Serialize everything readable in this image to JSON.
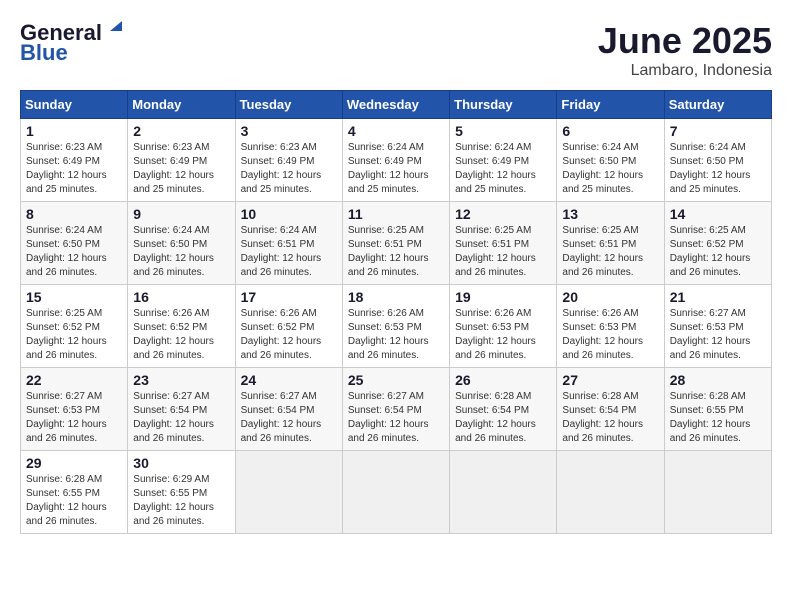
{
  "header": {
    "logo_line1": "General",
    "logo_line2": "Blue",
    "month": "June 2025",
    "location": "Lambaro, Indonesia"
  },
  "weekdays": [
    "Sunday",
    "Monday",
    "Tuesday",
    "Wednesday",
    "Thursday",
    "Friday",
    "Saturday"
  ],
  "weeks": [
    [
      {
        "day": "1",
        "sunrise": "6:23 AM",
        "sunset": "6:49 PM",
        "daylight": "12 hours and 25 minutes."
      },
      {
        "day": "2",
        "sunrise": "6:23 AM",
        "sunset": "6:49 PM",
        "daylight": "12 hours and 25 minutes."
      },
      {
        "day": "3",
        "sunrise": "6:23 AM",
        "sunset": "6:49 PM",
        "daylight": "12 hours and 25 minutes."
      },
      {
        "day": "4",
        "sunrise": "6:24 AM",
        "sunset": "6:49 PM",
        "daylight": "12 hours and 25 minutes."
      },
      {
        "day": "5",
        "sunrise": "6:24 AM",
        "sunset": "6:49 PM",
        "daylight": "12 hours and 25 minutes."
      },
      {
        "day": "6",
        "sunrise": "6:24 AM",
        "sunset": "6:50 PM",
        "daylight": "12 hours and 25 minutes."
      },
      {
        "day": "7",
        "sunrise": "6:24 AM",
        "sunset": "6:50 PM",
        "daylight": "12 hours and 25 minutes."
      }
    ],
    [
      {
        "day": "8",
        "sunrise": "6:24 AM",
        "sunset": "6:50 PM",
        "daylight": "12 hours and 26 minutes."
      },
      {
        "day": "9",
        "sunrise": "6:24 AM",
        "sunset": "6:50 PM",
        "daylight": "12 hours and 26 minutes."
      },
      {
        "day": "10",
        "sunrise": "6:24 AM",
        "sunset": "6:51 PM",
        "daylight": "12 hours and 26 minutes."
      },
      {
        "day": "11",
        "sunrise": "6:25 AM",
        "sunset": "6:51 PM",
        "daylight": "12 hours and 26 minutes."
      },
      {
        "day": "12",
        "sunrise": "6:25 AM",
        "sunset": "6:51 PM",
        "daylight": "12 hours and 26 minutes."
      },
      {
        "day": "13",
        "sunrise": "6:25 AM",
        "sunset": "6:51 PM",
        "daylight": "12 hours and 26 minutes."
      },
      {
        "day": "14",
        "sunrise": "6:25 AM",
        "sunset": "6:52 PM",
        "daylight": "12 hours and 26 minutes."
      }
    ],
    [
      {
        "day": "15",
        "sunrise": "6:25 AM",
        "sunset": "6:52 PM",
        "daylight": "12 hours and 26 minutes."
      },
      {
        "day": "16",
        "sunrise": "6:26 AM",
        "sunset": "6:52 PM",
        "daylight": "12 hours and 26 minutes."
      },
      {
        "day": "17",
        "sunrise": "6:26 AM",
        "sunset": "6:52 PM",
        "daylight": "12 hours and 26 minutes."
      },
      {
        "day": "18",
        "sunrise": "6:26 AM",
        "sunset": "6:53 PM",
        "daylight": "12 hours and 26 minutes."
      },
      {
        "day": "19",
        "sunrise": "6:26 AM",
        "sunset": "6:53 PM",
        "daylight": "12 hours and 26 minutes."
      },
      {
        "day": "20",
        "sunrise": "6:26 AM",
        "sunset": "6:53 PM",
        "daylight": "12 hours and 26 minutes."
      },
      {
        "day": "21",
        "sunrise": "6:27 AM",
        "sunset": "6:53 PM",
        "daylight": "12 hours and 26 minutes."
      }
    ],
    [
      {
        "day": "22",
        "sunrise": "6:27 AM",
        "sunset": "6:53 PM",
        "daylight": "12 hours and 26 minutes."
      },
      {
        "day": "23",
        "sunrise": "6:27 AM",
        "sunset": "6:54 PM",
        "daylight": "12 hours and 26 minutes."
      },
      {
        "day": "24",
        "sunrise": "6:27 AM",
        "sunset": "6:54 PM",
        "daylight": "12 hours and 26 minutes."
      },
      {
        "day": "25",
        "sunrise": "6:27 AM",
        "sunset": "6:54 PM",
        "daylight": "12 hours and 26 minutes."
      },
      {
        "day": "26",
        "sunrise": "6:28 AM",
        "sunset": "6:54 PM",
        "daylight": "12 hours and 26 minutes."
      },
      {
        "day": "27",
        "sunrise": "6:28 AM",
        "sunset": "6:54 PM",
        "daylight": "12 hours and 26 minutes."
      },
      {
        "day": "28",
        "sunrise": "6:28 AM",
        "sunset": "6:55 PM",
        "daylight": "12 hours and 26 minutes."
      }
    ],
    [
      {
        "day": "29",
        "sunrise": "6:28 AM",
        "sunset": "6:55 PM",
        "daylight": "12 hours and 26 minutes."
      },
      {
        "day": "30",
        "sunrise": "6:29 AM",
        "sunset": "6:55 PM",
        "daylight": "12 hours and 26 minutes."
      },
      null,
      null,
      null,
      null,
      null
    ]
  ]
}
